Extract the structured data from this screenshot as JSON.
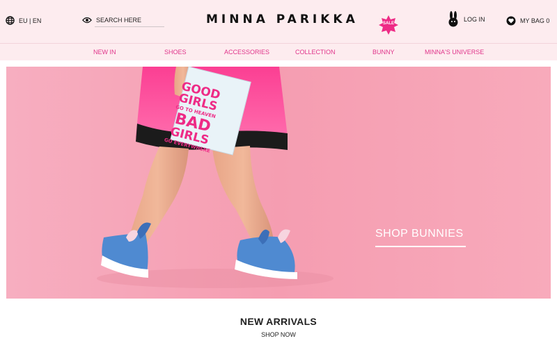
{
  "header": {
    "region": "EU | EN",
    "search_label": "SEARCH HERE",
    "brand": "MINNA PARIKKA",
    "sale_badge": "SALE",
    "login": "LOG IN",
    "bag": "MY BAG 0"
  },
  "nav": [
    "NEW IN",
    "SHOES",
    "ACCESSORIES",
    "COLLECTION",
    "BUNNY",
    "MINNA'S UNIVERSE"
  ],
  "hero": {
    "book_lines": [
      "GOOD",
      "GIRLS",
      "GO TO HEAVEN",
      "BAD",
      "GIRLS",
      "GO EVERYWHERE"
    ],
    "cta": "SHOP BUNNIES"
  },
  "section": {
    "title": "NEW ARRIVALS",
    "link": "SHOP NOW"
  },
  "colors": {
    "header_bg": "#fdecef",
    "nav_pink": "#e0338a",
    "hero_bg": "#f5a3b4",
    "sale_badge": "#ee2b86"
  },
  "icons": [
    "globe-icon",
    "eye-icon",
    "sale-star-icon",
    "bunny-icon",
    "heart-icon"
  ]
}
